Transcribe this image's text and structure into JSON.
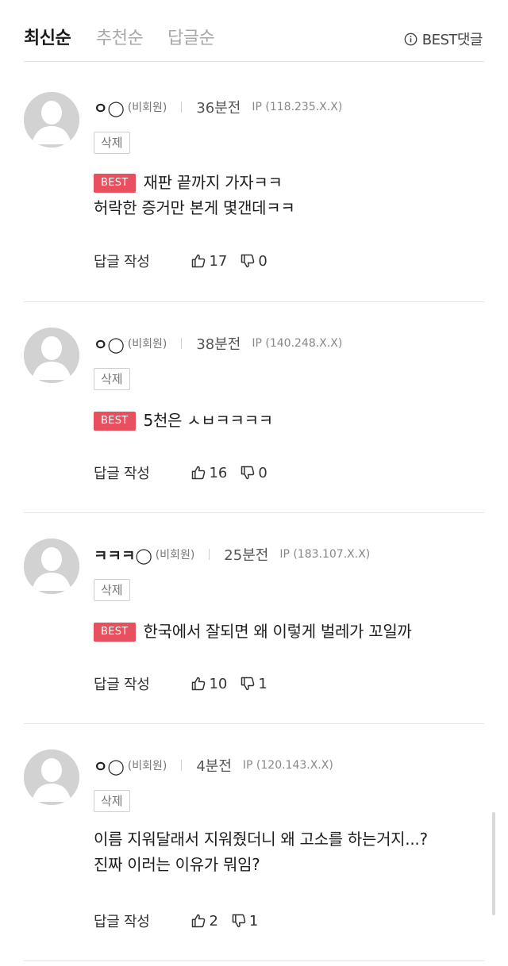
{
  "tabs": {
    "latest": "최신순",
    "recommended": "추천순",
    "replies": "답글순",
    "best_comments": "BEST댓글"
  },
  "colors": {
    "best_badge": "#e9505f",
    "avatar": "#d2d2d2"
  },
  "comments": [
    {
      "nickname": "ㅇ◯",
      "guest_label": "(비회원)",
      "time": "36분전",
      "ip": "IP (118.235.X.X)",
      "delete_label": "삭제",
      "badge": "BEST",
      "lines": [
        "재판 끝까지 가자ㅋㅋ",
        "허락한 증거만 본게 몇갠데ㅋㅋ"
      ],
      "reply_label": "답글 작성",
      "likes": "17",
      "dislikes": "0"
    },
    {
      "nickname": "ㅇ◯",
      "guest_label": "(비회원)",
      "time": "38분전",
      "ip": "IP (140.248.X.X)",
      "delete_label": "삭제",
      "badge": "BEST",
      "lines": [
        "5천은 ㅅㅂㅋㅋㅋㅋ"
      ],
      "reply_label": "답글 작성",
      "likes": "16",
      "dislikes": "0"
    },
    {
      "nickname": "ㅋㅋㅋ◯",
      "guest_label": "(비회원)",
      "time": "25분전",
      "ip": "IP (183.107.X.X)",
      "delete_label": "삭제",
      "badge": "BEST",
      "lines": [
        "한국에서 잘되면 왜 이렇게 벌레가 꼬일까"
      ],
      "reply_label": "답글 작성",
      "likes": "10",
      "dislikes": "1"
    },
    {
      "nickname": "ㅇ◯",
      "guest_label": "(비회원)",
      "time": "4분전",
      "ip": "IP (120.143.X.X)",
      "delete_label": "삭제",
      "badge": "",
      "lines": [
        "이름 지워달래서 지워줬더니 왜 고소를 하는거지...?",
        "진짜 이러는 이유가 뭐임?"
      ],
      "reply_label": "답글 작성",
      "likes": "2",
      "dislikes": "1"
    }
  ]
}
